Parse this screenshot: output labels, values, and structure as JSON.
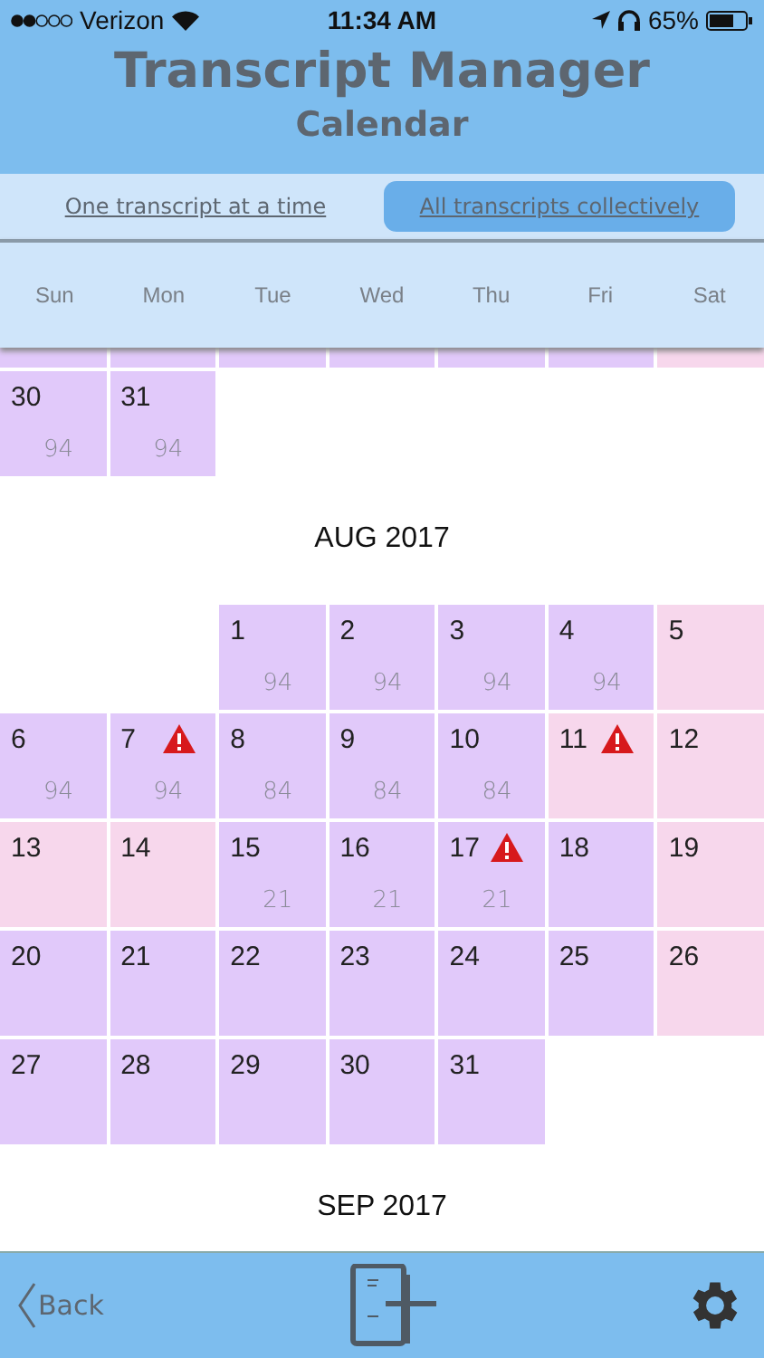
{
  "status_bar": {
    "carrier": "Verizon",
    "time": "11:34 AM",
    "battery": "65%"
  },
  "header": {
    "title": "Transcript Manager",
    "subtitle": "Calendar"
  },
  "modes": [
    {
      "label": "One transcript at a time",
      "selected": false
    },
    {
      "label": "All transcripts collectively",
      "selected": true
    }
  ],
  "weekdays": [
    "Sun",
    "Mon",
    "Tue",
    "Wed",
    "Thu",
    "Fri",
    "Sat"
  ],
  "months": [
    {
      "clipped_row": [
        {
          "color": "#e1c9fa"
        },
        {
          "color": "#e1c9fa"
        },
        {
          "color": "#e1c9fa"
        },
        {
          "color": "#e1c9fa"
        },
        {
          "color": "#e1c9fa"
        },
        {
          "color": "#e1c9fa"
        },
        {
          "color": "#f7d7ec"
        }
      ],
      "weeks": [
        [
          {
            "kind": "day",
            "day": "30",
            "count": "94",
            "alert": false,
            "color": "#e1c9fa"
          },
          {
            "kind": "day",
            "day": "31",
            "count": "94",
            "alert": false,
            "color": "#e1c9fa"
          },
          {
            "kind": "blank"
          },
          {
            "kind": "blank"
          },
          {
            "kind": "blank"
          },
          {
            "kind": "blank"
          },
          {
            "kind": "blank"
          }
        ]
      ]
    },
    {
      "title": "AUG 2017",
      "weeks": [
        [
          {
            "kind": "blank"
          },
          {
            "kind": "blank"
          },
          {
            "kind": "day",
            "day": "1",
            "count": "94",
            "alert": false,
            "color": "#e1c9fa"
          },
          {
            "kind": "day",
            "day": "2",
            "count": "94",
            "alert": false,
            "color": "#e1c9fa"
          },
          {
            "kind": "day",
            "day": "3",
            "count": "94",
            "alert": false,
            "color": "#e1c9fa"
          },
          {
            "kind": "day",
            "day": "4",
            "count": "94",
            "alert": false,
            "color": "#e1c9fa"
          },
          {
            "kind": "day",
            "day": "5",
            "alert": false,
            "color": "#f7d7ec"
          }
        ],
        [
          {
            "kind": "day",
            "day": "6",
            "count": "94",
            "alert": false,
            "color": "#e1c9fa"
          },
          {
            "kind": "day",
            "day": "7",
            "count": "94",
            "alert": true,
            "color": "#e1c9fa"
          },
          {
            "kind": "day",
            "day": "8",
            "count": "84",
            "alert": false,
            "color": "#e1c9fa"
          },
          {
            "kind": "day",
            "day": "9",
            "count": "84",
            "alert": false,
            "color": "#e1c9fa"
          },
          {
            "kind": "day",
            "day": "10",
            "count": "84",
            "alert": false,
            "color": "#e1c9fa"
          },
          {
            "kind": "day",
            "day": "11",
            "alert": true,
            "color": "#f7d7ec"
          },
          {
            "kind": "day",
            "day": "12",
            "alert": false,
            "color": "#f7d7ec"
          }
        ],
        [
          {
            "kind": "day",
            "day": "13",
            "alert": false,
            "color": "#f7d7ec"
          },
          {
            "kind": "day",
            "day": "14",
            "alert": false,
            "color": "#f7d7ec"
          },
          {
            "kind": "day",
            "day": "15",
            "count": "21",
            "alert": false,
            "color": "#e1c9fa"
          },
          {
            "kind": "day",
            "day": "16",
            "count": "21",
            "alert": false,
            "color": "#e1c9fa"
          },
          {
            "kind": "day",
            "day": "17",
            "count": "21",
            "alert": true,
            "color": "#e1c9fa"
          },
          {
            "kind": "day",
            "day": "18",
            "alert": false,
            "color": "#e1c9fa"
          },
          {
            "kind": "day",
            "day": "19",
            "alert": false,
            "color": "#f7d7ec"
          }
        ],
        [
          {
            "kind": "day",
            "day": "20",
            "alert": false,
            "color": "#e1c9fa"
          },
          {
            "kind": "day",
            "day": "21",
            "alert": false,
            "color": "#e1c9fa"
          },
          {
            "kind": "day",
            "day": "22",
            "alert": false,
            "color": "#e1c9fa"
          },
          {
            "kind": "day",
            "day": "23",
            "alert": false,
            "color": "#e1c9fa"
          },
          {
            "kind": "day",
            "day": "24",
            "alert": false,
            "color": "#e1c9fa"
          },
          {
            "kind": "day",
            "day": "25",
            "alert": false,
            "color": "#e1c9fa"
          },
          {
            "kind": "day",
            "day": "26",
            "alert": false,
            "color": "#f7d7ec"
          }
        ],
        [
          {
            "kind": "day",
            "day": "27",
            "alert": false,
            "color": "#e1c9fa"
          },
          {
            "kind": "day",
            "day": "28",
            "alert": false,
            "color": "#e1c9fa"
          },
          {
            "kind": "day",
            "day": "29",
            "alert": false,
            "color": "#e1c9fa"
          },
          {
            "kind": "day",
            "day": "30",
            "alert": false,
            "color": "#e1c9fa"
          },
          {
            "kind": "day",
            "day": "31",
            "alert": false,
            "color": "#e1c9fa"
          },
          {
            "kind": "blank"
          },
          {
            "kind": "blank"
          }
        ]
      ]
    },
    {
      "title": "SEP 2017"
    }
  ],
  "bottom_bar": {
    "back": "Back"
  }
}
